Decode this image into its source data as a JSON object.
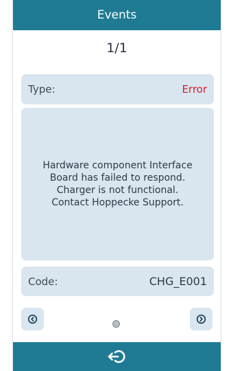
{
  "header": {
    "title": "Events"
  },
  "pagination": {
    "counter": "1/1"
  },
  "event": {
    "type_label": "Type:",
    "type_value": "Error",
    "message": "Hardware component Interface\nBoard has failed to respond.\nCharger is not functional.\nContact Hoppecke Support.",
    "code_label": "Code:",
    "code_value": "CHG_E001"
  },
  "navigation": {
    "prev_icon": "chevron-left-circle-icon",
    "next_icon": "chevron-right-circle-icon",
    "exit_icon": "exit-arrow-icon"
  },
  "colors": {
    "brand": "#1f7b94",
    "panel": "#d9e5ef",
    "error": "#d51f2b"
  }
}
